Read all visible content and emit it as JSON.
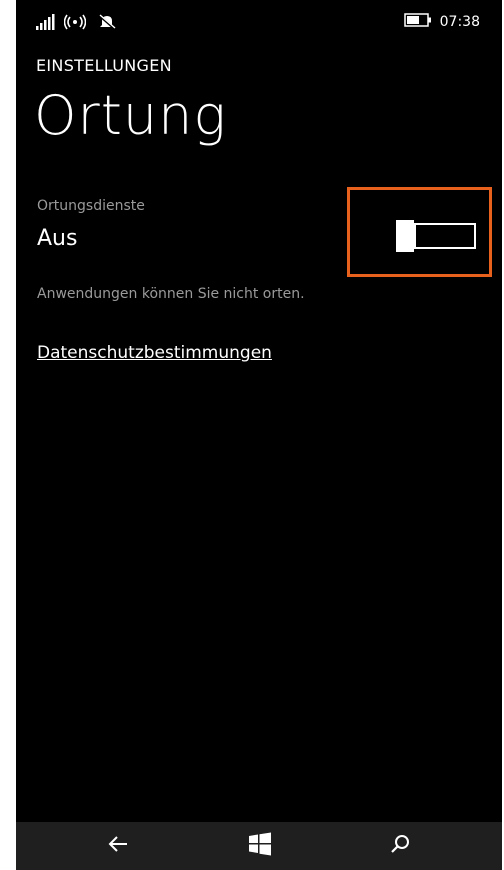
{
  "statusbar": {
    "time": "07:38",
    "icons": [
      "signal-icon",
      "wifi-icon",
      "silent-mode-icon",
      "battery-icon"
    ]
  },
  "header": {
    "app_title": "EINSTELLUNGEN",
    "page_title": "Ortung"
  },
  "location_setting": {
    "label": "Ortungsdienste",
    "state": "Aus",
    "toggle_on": false,
    "description": "Anwendungen können Sie nicht orten."
  },
  "links": {
    "privacy": "Datenschutzbestimmungen"
  },
  "navbar": {
    "icons": [
      "back-arrow-icon",
      "windows-start-icon",
      "search-icon"
    ]
  },
  "colors": {
    "background": "#000000",
    "foreground": "#ffffff",
    "secondary_text": "#9a9a9a",
    "highlight": "#e8621d",
    "navbar": "#1f1f1f"
  }
}
